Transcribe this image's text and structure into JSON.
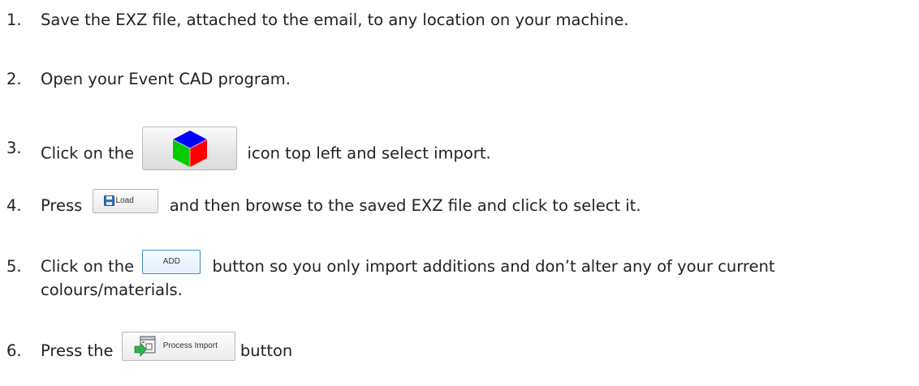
{
  "steps": [
    {
      "number": "1.",
      "text": "Save the EXZ file, attached to the email, to any location on your machine."
    },
    {
      "number": "2.",
      "text": "Open your Event CAD program."
    },
    {
      "number": "3.",
      "before": "Click on the",
      "after": "icon top left and select import."
    },
    {
      "number": "4.",
      "before": "Press",
      "button_label": "Load",
      "after": "and then browse to the saved EXZ file and click to select it."
    },
    {
      "number": "5.",
      "before": "Click on the",
      "button_label": "ADD",
      "after": "button so you only import additions and don’t alter any of your current",
      "continuation": "colours/materials."
    },
    {
      "number": "6.",
      "before": "Press the",
      "button_label": "Process Import",
      "after": "button"
    }
  ],
  "colors": {
    "text": "#222222",
    "add_border": "#3c8fd6",
    "cube_top": "#0000ff",
    "cube_left": "#00cc00",
    "cube_right": "#ff0000"
  }
}
